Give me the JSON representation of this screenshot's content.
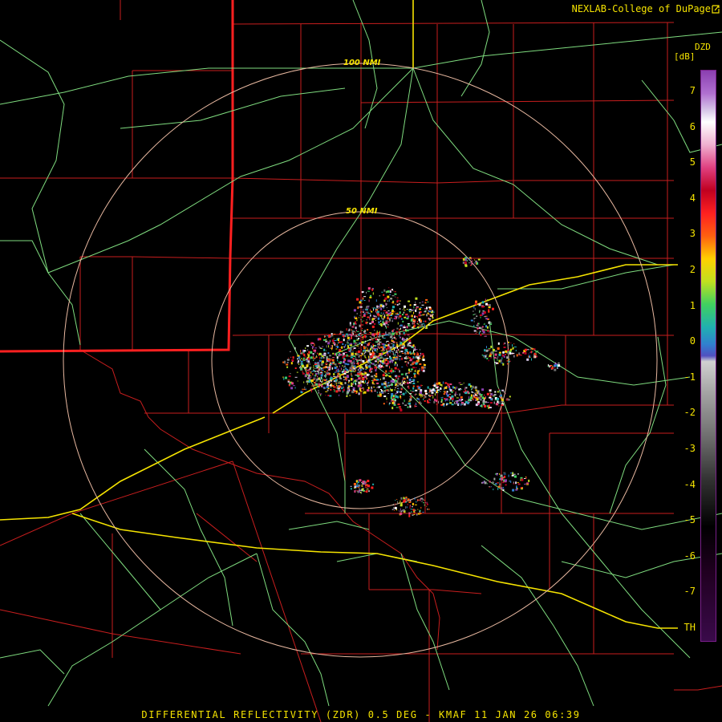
{
  "credit": "NEXLAB-College of DuPage",
  "credit_icon": "external-link-icon",
  "range_rings": [
    {
      "label": "100 NMI"
    },
    {
      "label": "50 NMI"
    }
  ],
  "legend": {
    "product": "DZD",
    "unit": "[dB]",
    "ticks": [
      "7",
      "6",
      "5",
      "4",
      "3",
      "2",
      "1",
      "0",
      "-1",
      "-2",
      "-3",
      "-4",
      "-5",
      "-6",
      "-7",
      "TH"
    ]
  },
  "footer": "DIFFERENTIAL REFLECTIVITY (ZDR) 0.5 DEG - KMAF 11 JAN 26 06:39",
  "colors": {
    "text": "#f5e300",
    "county_lines": "#c81e1e",
    "state_line": "#ff2020",
    "roads": "#7fdc7f",
    "interstate": "#f5e300",
    "range_rings": "#e8b8a0"
  }
}
